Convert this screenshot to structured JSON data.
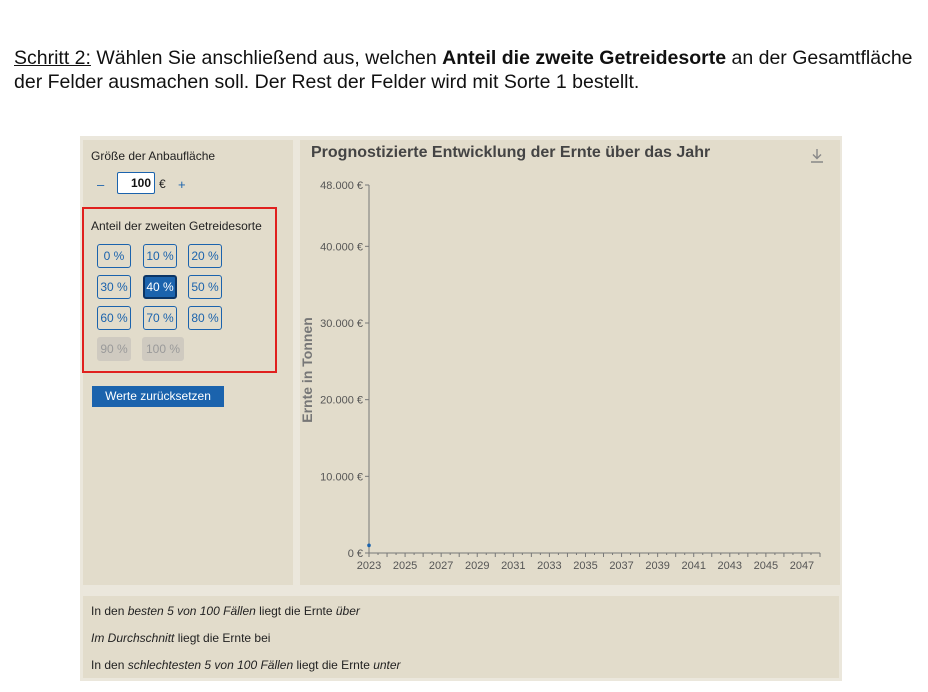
{
  "instruction": {
    "step_label": "Schritt 2:",
    "text_1": " Wählen Sie anschließend aus, welchen ",
    "bold": "Anteil die zweite Getreidesorte",
    "text_2": " an der Gesamtfläche der Felder ausmachen soll. Der Rest der Felder wird mit Sorte 1 bestellt."
  },
  "controls": {
    "size_label": "Größe der Anbaufläche",
    "minus": "–",
    "size_value": "100",
    "size_unit": "€",
    "plus": "+",
    "share_label": "Anteil der zweiten Getreidesorte",
    "share_buttons": [
      "0 %",
      "10 %",
      "20 %",
      "30 %",
      "40 %",
      "50 %",
      "60 %",
      "70 %",
      "80 %",
      "90 %",
      "100 %"
    ],
    "selected_share": "40 %",
    "disabled_shares": [
      "90 %",
      "100 %"
    ],
    "reset_label": "Werte zurücksetzen"
  },
  "chart": {
    "title": "Prognostizierte Entwicklung der Ernte über das Jahr",
    "download_icon": "download-icon",
    "ylabel": "Ernte in Tonnen"
  },
  "chart_data": {
    "type": "line",
    "title": "Prognostizierte Entwicklung der Ernte über das Jahr",
    "xlabel": "",
    "ylabel": "Ernte in Tonnen",
    "x_ticks": [
      "2023",
      "2025",
      "2027",
      "2029",
      "2031",
      "2033",
      "2035",
      "2037",
      "2039",
      "2041",
      "2043",
      "2045",
      "2047"
    ],
    "y_ticks": [
      "0 €",
      "10.000 €",
      "20.000 €",
      "30.000 €",
      "40.000 €",
      "48.000 €"
    ],
    "y_tick_values": [
      0,
      10000,
      20000,
      30000,
      40000,
      48000
    ],
    "xlim": [
      2023,
      2048
    ],
    "ylim": [
      0,
      48000
    ],
    "series": [
      {
        "x": [
          2023
        ],
        "values": [
          1000
        ]
      }
    ]
  },
  "summary": {
    "line_1": {
      "a": "In den ",
      "b": "besten 5 von 100 Fällen",
      "c": " liegt die Ernte ",
      "d": "über"
    },
    "line_2": {
      "a": "Im Durchschnitt",
      "b": " liegt die Ernte bei"
    },
    "line_3": {
      "a": "In den ",
      "b": "schlechtesten 5 von 100 Fällen",
      "c": " liegt die Ernte ",
      "d": "unter"
    }
  },
  "colors": {
    "accent": "#1b63ad",
    "highlight_box": "#e0201e",
    "panel": "#e2dccb"
  }
}
